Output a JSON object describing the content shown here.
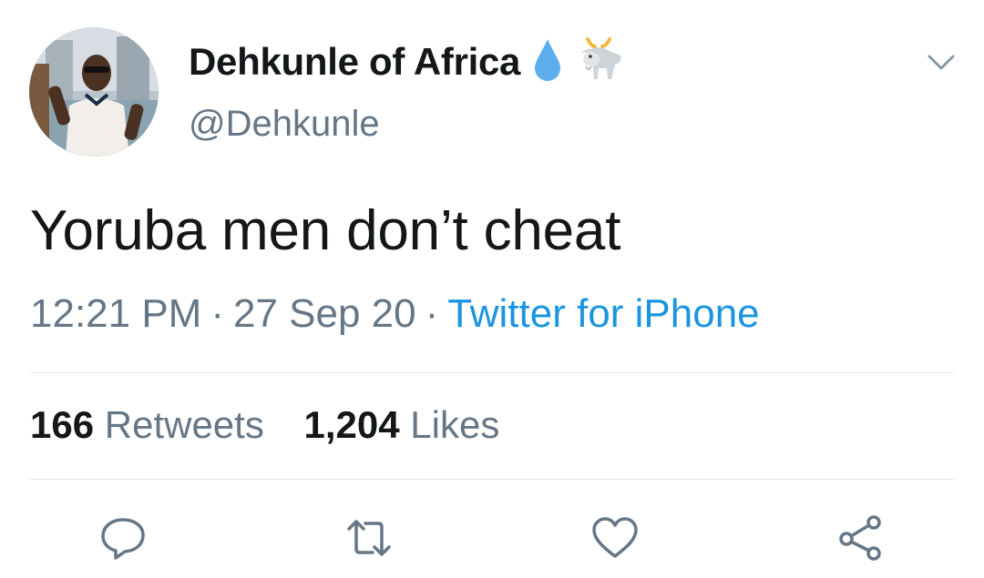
{
  "tweet": {
    "display_name": "Dehkunle of Africa",
    "name_emojis": [
      "droplet-icon",
      "goat-icon"
    ],
    "handle": "@Dehkunle",
    "text": "Yoruba men don’t cheat",
    "time": "12:21 PM",
    "date": "27 Sep 20",
    "separator": "·",
    "source": "Twitter for iPhone",
    "retweets_count": "166",
    "retweets_label": "Retweets",
    "likes_count": "1,204",
    "likes_label": "Likes"
  },
  "colors": {
    "text_primary": "#14171a",
    "text_secondary": "#657786",
    "link_blue": "#1b95e0",
    "divider": "#e1e8ed",
    "icon_gray": "#657786"
  },
  "actions": [
    "reply-icon",
    "retweet-icon",
    "like-icon",
    "share-icon"
  ]
}
